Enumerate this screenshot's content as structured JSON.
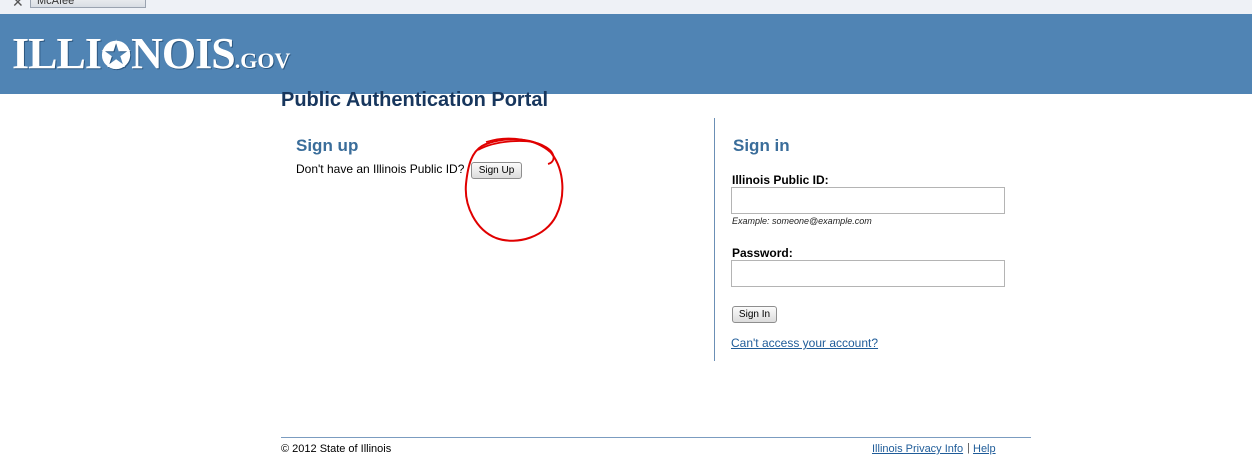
{
  "browser": {
    "close_glyph": "✕",
    "toolbar_label": "McAfee"
  },
  "header": {
    "logo_text_left": "ILLI",
    "logo_star": "✪",
    "logo_text_right": "NOIS",
    "logo_suffix": ".GOV",
    "background_color": "#5084b4"
  },
  "page": {
    "title": "Public Authentication Portal"
  },
  "signup": {
    "heading": "Sign up",
    "prompt": "Don't have an Illinois Public ID?",
    "button_label": "Sign Up",
    "annotation_color": "#e00000"
  },
  "signin": {
    "heading": "Sign in",
    "id_label": "Illinois Public ID:",
    "id_value": "",
    "id_example": "Example: someone@example.com",
    "password_label": "Password:",
    "password_value": "",
    "button_label": "Sign In",
    "cant_access_link": "Can't access your account?"
  },
  "footer": {
    "copyright": "© 2012 State of Illinois",
    "privacy_link": "Illinois Privacy Info",
    "separator": "|",
    "help_link": "Help"
  },
  "colors": {
    "heading_blue": "#3a6d9a",
    "title_navy": "#17365d",
    "link_blue": "#1f5c99"
  }
}
